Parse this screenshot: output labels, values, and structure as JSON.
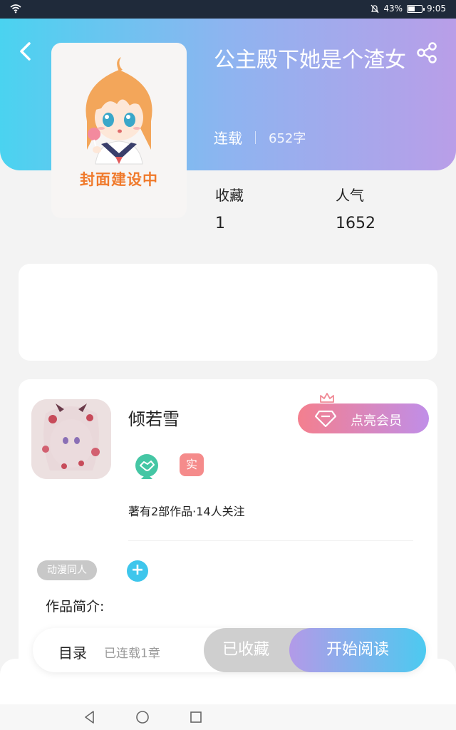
{
  "status": {
    "battery": "43%",
    "time": "9:05"
  },
  "book": {
    "title": "公主殿下她是个渣女",
    "status": "连载",
    "word_count": "652字",
    "cover_text": "封面建设中"
  },
  "stats": [
    {
      "label": "收藏",
      "value": "1"
    },
    {
      "label": "人气",
      "value": "1652"
    }
  ],
  "author": {
    "name": "倾若雪",
    "real_badge": "实",
    "works_info": "著有2部作品·14人关注",
    "vip_button": "点亮会员"
  },
  "tags": [
    "动漫同人"
  ],
  "intro_label": "作品简介:",
  "action_bar": {
    "toc_label": "目录",
    "toc_sub": "已连载1章",
    "favorited_label": "已收藏",
    "read_label": "开始阅读"
  },
  "colors": {
    "hero_gradient_start": "#4ad3f0",
    "hero_gradient_end": "#b99ee8",
    "cover_text": "#f07a2c",
    "vip_start": "#f47f8e",
    "vip_end": "#c08ee8",
    "accent_blue": "#3ec6ec"
  }
}
